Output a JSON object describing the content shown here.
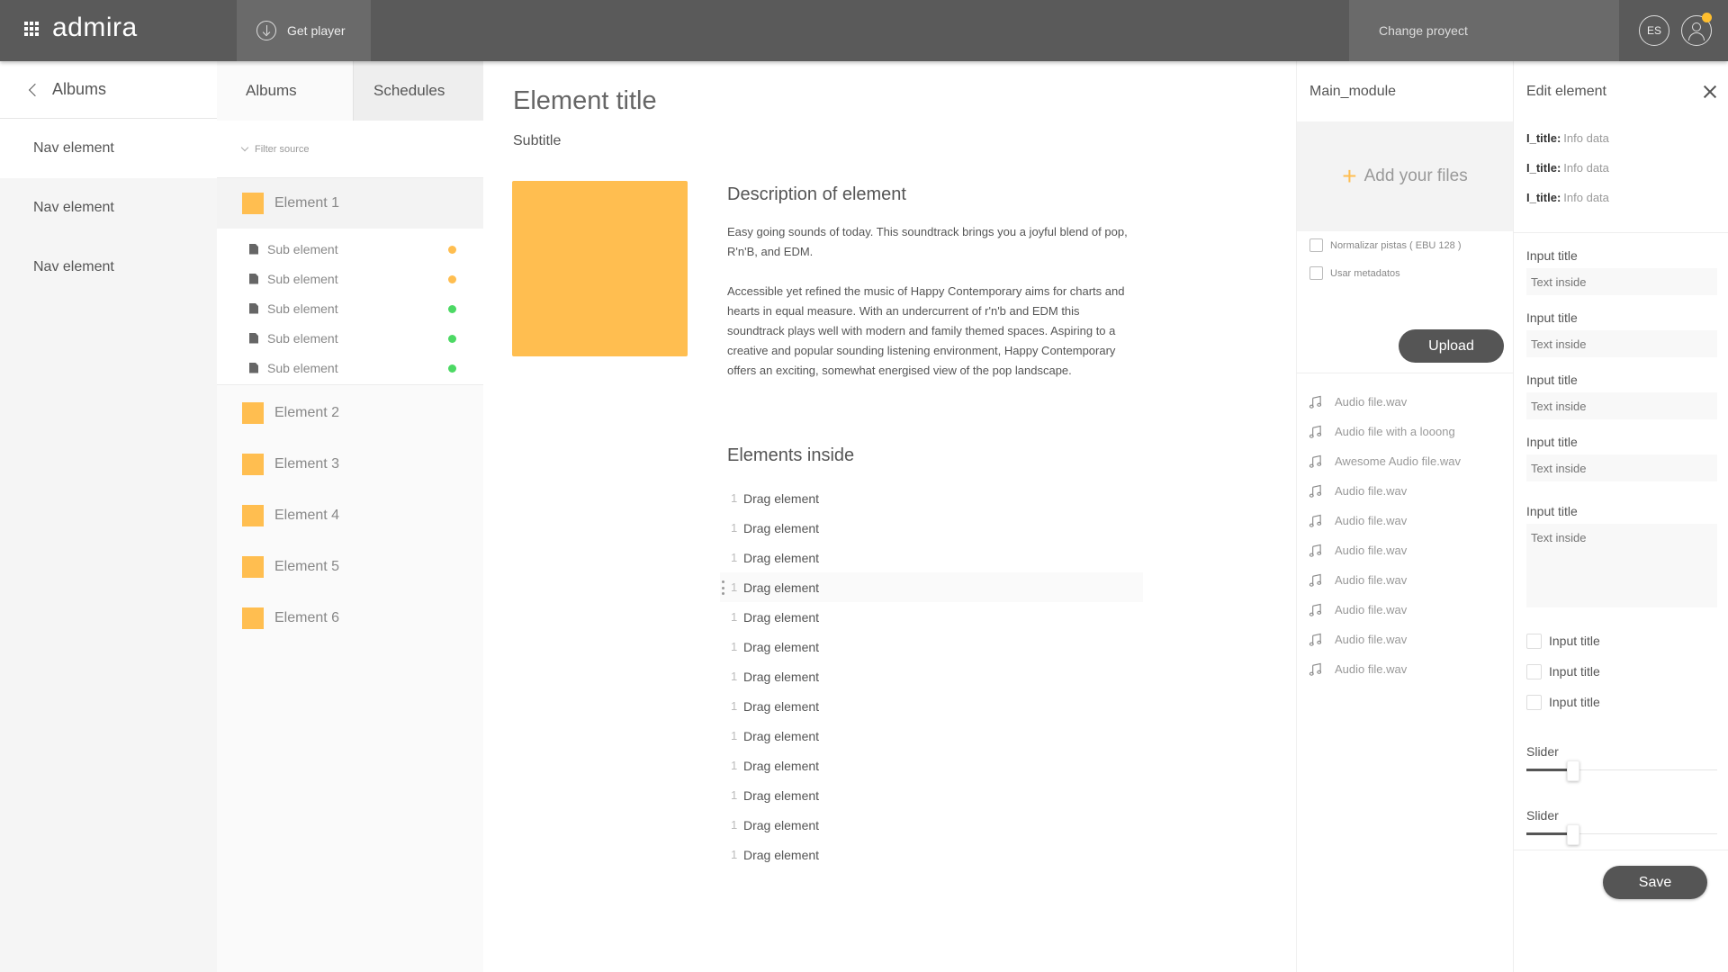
{
  "topbar": {
    "logo": "admira",
    "get_player": "Get player",
    "change_project": "Change proyect",
    "lang": "ES"
  },
  "leftnav": {
    "back_label": "Albums",
    "items": [
      {
        "label": "Nav element"
      },
      {
        "label": "Nav element"
      },
      {
        "label": "Nav element"
      }
    ]
  },
  "albums": {
    "tabs": [
      {
        "label": "Albums"
      },
      {
        "label": "Schedules"
      }
    ],
    "filter_placeholder": "Filter source",
    "elements": [
      {
        "label": "Element 1"
      },
      {
        "label": "Element 2"
      },
      {
        "label": "Element 3"
      },
      {
        "label": "Element 4"
      },
      {
        "label": "Element 5"
      },
      {
        "label": "Element 6"
      }
    ],
    "sub_elements": [
      {
        "label": "Sub element",
        "status_color": "#ffbe50"
      },
      {
        "label": "Sub element",
        "status_color": "#ffbe50"
      },
      {
        "label": "Sub element",
        "status_color": "#4cd964"
      },
      {
        "label": "Sub element",
        "status_color": "#4cd964"
      },
      {
        "label": "Sub element",
        "status_color": "#4cd964"
      }
    ]
  },
  "main": {
    "title": "Element title",
    "subtitle": "Subtitle",
    "description_title": "Description of element",
    "description_p1": "Easy going sounds of today. This soundtrack brings you a joyful blend of pop, R'n'B, and EDM.",
    "description_p2": "Accessible yet refined the music of Happy Contemporary aims for charts and hearts in equal measure. With an undercurrent of r'n'b and EDM this soundtrack plays well with modern and family themed spaces. Aspiring to a creative and popular sounding listening environment, Happy Contemporary offers an exciting, somewhat energised view of the pop landscape.",
    "elements_inside_title": "Elements inside",
    "drag_items": [
      {
        "num": "1",
        "label": "Drag element"
      },
      {
        "num": "1",
        "label": "Drag element"
      },
      {
        "num": "1",
        "label": "Drag element"
      },
      {
        "num": "1",
        "label": "Drag element"
      },
      {
        "num": "1",
        "label": "Drag element"
      },
      {
        "num": "1",
        "label": "Drag element"
      },
      {
        "num": "1",
        "label": "Drag element"
      },
      {
        "num": "1",
        "label": "Drag element"
      },
      {
        "num": "1",
        "label": "Drag element"
      },
      {
        "num": "1",
        "label": "Drag element"
      },
      {
        "num": "1",
        "label": "Drag element"
      },
      {
        "num": "1",
        "label": "Drag element"
      },
      {
        "num": "1",
        "label": "Drag element"
      }
    ]
  },
  "upload": {
    "module_title": "Main_module",
    "dropzone_label": "Add your files",
    "normalize_label": "Normalizar pistas ( EBU 128 )",
    "metadata_label": "Usar metadatos",
    "upload_button": "Upload",
    "files": [
      {
        "name": "Audio file.wav"
      },
      {
        "name": "Audio file with a looong"
      },
      {
        "name": "Awesome Audio file.wav"
      },
      {
        "name": "Audio file.wav"
      },
      {
        "name": "Audio file.wav"
      },
      {
        "name": "Audio file.wav"
      },
      {
        "name": "Audio file.wav"
      },
      {
        "name": "Audio file.wav"
      },
      {
        "name": "Audio file.wav"
      },
      {
        "name": "Audio file.wav"
      }
    ]
  },
  "edit": {
    "title": "Edit element",
    "info": [
      {
        "key": "I_title:",
        "value": "Info data"
      },
      {
        "key": "I_title:",
        "value": "Info data"
      },
      {
        "key": "I_title:",
        "value": "Info data"
      }
    ],
    "inputs": [
      {
        "label": "Input title",
        "placeholder": "Text inside"
      },
      {
        "label": "Input title",
        "placeholder": "Text inside"
      },
      {
        "label": "Input title",
        "placeholder": "Text inside"
      },
      {
        "label": "Input title",
        "placeholder": "Text inside"
      }
    ],
    "textarea": {
      "label": "Input title",
      "placeholder": "Text inside"
    },
    "checkboxes": [
      {
        "label": "Input title"
      },
      {
        "label": "Input title"
      },
      {
        "label": "Input title"
      }
    ],
    "sliders": [
      {
        "label": "Slider",
        "value_fraction": 0.22
      },
      {
        "label": "Slider",
        "value_fraction": 0.22
      }
    ],
    "save_button": "Save"
  },
  "colors": {
    "accent": "#ffbe50",
    "topbar": "#5a5a5a",
    "notification": "#ffbe2e",
    "status_green": "#4cd964"
  }
}
